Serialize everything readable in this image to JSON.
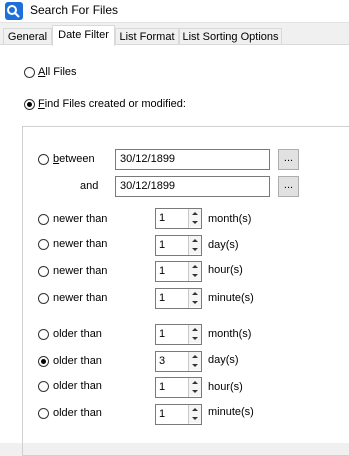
{
  "window": {
    "title": "Search For Files",
    "icon": "search-files-app-icon"
  },
  "tabs": [
    {
      "label": "General"
    },
    {
      "label": "Date Filter",
      "selected": true
    },
    {
      "label": "List Format"
    },
    {
      "label": "List Sorting Options"
    }
  ],
  "mode": {
    "all_files": {
      "prefix": "",
      "accel": "A",
      "rest": "ll Files",
      "checked": false
    },
    "find_created": {
      "prefix": "",
      "accel": "F",
      "rest": "ind Files created or modified:",
      "checked": true
    }
  },
  "between": {
    "prefix": "",
    "accel": "b",
    "rest": "etween",
    "checked": false,
    "from_value": "30/12/1899",
    "and_label": "and",
    "to_value": "30/12/1899",
    "button_label": "..."
  },
  "newer": [
    {
      "label": "newer than",
      "value": "1",
      "unit": "month(s)",
      "checked": false
    },
    {
      "label": "newer than",
      "value": "1",
      "unit": "day(s)",
      "checked": false
    },
    {
      "label": "newer than",
      "value": "1",
      "unit": "hour(s)",
      "checked": false
    },
    {
      "label": "newer than",
      "value": "1",
      "unit": "minute(s)",
      "checked": false
    }
  ],
  "older": [
    {
      "label": "older than",
      "value": "1",
      "unit": "month(s)",
      "checked": false
    },
    {
      "label": "older than",
      "value": "3",
      "unit": "day(s)",
      "checked": true
    },
    {
      "label": "older than",
      "value": "1",
      "unit": "hour(s)",
      "checked": false
    },
    {
      "label": "older than",
      "value": "1",
      "unit": "minute(s)",
      "checked": false
    }
  ]
}
